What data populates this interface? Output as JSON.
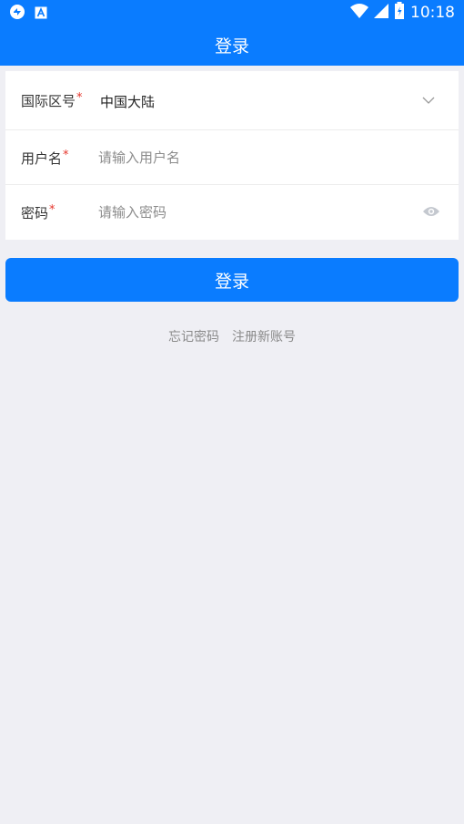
{
  "status_bar": {
    "time": "10:18",
    "icons": [
      "sync-icon",
      "a-notification-icon",
      "wifi-icon",
      "signal-icon",
      "battery-icon"
    ]
  },
  "nav": {
    "title": "登录"
  },
  "form": {
    "region": {
      "label": "国际区号",
      "required": "*",
      "value": "中国大陆"
    },
    "username": {
      "label": "用户名",
      "required": "*",
      "placeholder": "请输入用户名",
      "value": ""
    },
    "password": {
      "label": "密码",
      "required": "*",
      "placeholder": "请输入密码",
      "value": ""
    }
  },
  "login_button": {
    "label": "登录"
  },
  "links": {
    "forgot_password": "忘记密码",
    "register": "注册新账号"
  },
  "colors": {
    "primary": "#0a7cff",
    "background": "#efeff4",
    "required": "#e5352b",
    "muted_text": "#8a8a8a"
  }
}
